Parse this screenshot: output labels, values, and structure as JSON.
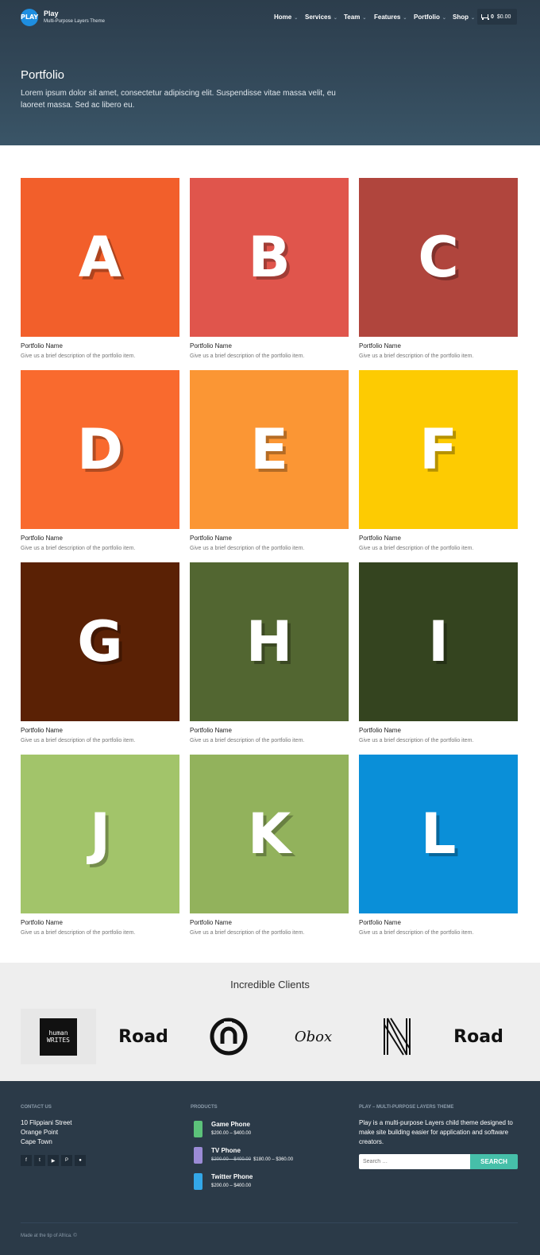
{
  "header": {
    "logo_text": "PLAY",
    "site_name": "Play",
    "tagline": "Multi-Purpose Layers Theme",
    "nav": [
      {
        "label": "Home",
        "caret": "⌄"
      },
      {
        "label": "Services",
        "caret": "⌄"
      },
      {
        "label": "Team",
        "caret": "⌄"
      },
      {
        "label": "Features",
        "caret": "⌄"
      },
      {
        "label": "Portfolio",
        "caret": "⌄"
      },
      {
        "label": "Shop",
        "caret": "⌄"
      }
    ],
    "cart": {
      "count": "0",
      "total": "$0.00",
      "icon": "cart-icon"
    }
  },
  "hero": {
    "title": "Portfolio",
    "description": "Lorem ipsum dolor sit amet, consectetur adipiscing elit. Suspendisse vitae massa velit, eu laoreet massa. Sed ac libero eu."
  },
  "portfolio": [
    {
      "letter": "A",
      "color": "#f25f2b",
      "name": "Portfolio Name",
      "desc": "Give us a brief description of the portfolio item."
    },
    {
      "letter": "B",
      "color": "#e0554c",
      "name": "Portfolio Name",
      "desc": "Give us a brief description of the portfolio item."
    },
    {
      "letter": "C",
      "color": "#b0453d",
      "name": "Portfolio Name",
      "desc": "Give us a brief description of the portfolio item."
    },
    {
      "letter": "D",
      "color": "#f96a2e",
      "name": "Portfolio Name",
      "desc": "Give us a brief description of the portfolio item."
    },
    {
      "letter": "E",
      "color": "#fb9634",
      "name": "Portfolio Name",
      "desc": "Give us a brief description of the portfolio item."
    },
    {
      "letter": "F",
      "color": "#fdcb02",
      "name": "Portfolio Name",
      "desc": "Give us a brief description of the portfolio item."
    },
    {
      "letter": "G",
      "color": "#5a2105",
      "name": "Portfolio Name",
      "desc": "Give us a brief description of the portfolio item."
    },
    {
      "letter": "H",
      "color": "#526631",
      "name": "Portfolio Name",
      "desc": "Give us a brief description of the portfolio item."
    },
    {
      "letter": "I",
      "color": "#34441f",
      "name": "Portfolio Name",
      "desc": "Give us a brief description of the portfolio item."
    },
    {
      "letter": "J",
      "color": "#a2c46a",
      "name": "Portfolio Name",
      "desc": "Give us a brief description of the portfolio item."
    },
    {
      "letter": "K",
      "color": "#92b25c",
      "name": "Portfolio Name",
      "desc": "Give us a brief description of the portfolio item."
    },
    {
      "letter": "L",
      "color": "#0a8fd8",
      "name": "Portfolio Name",
      "desc": "Give us a brief description of the portfolio item."
    }
  ],
  "clients": {
    "title": "Incredible Clients",
    "logos": [
      {
        "name": "human-writes-logo",
        "text": "human WRITES"
      },
      {
        "name": "road-logo",
        "text": "Road"
      },
      {
        "name": "n-circle-logo",
        "text": ""
      },
      {
        "name": "obox-logo",
        "text": "Obox"
      },
      {
        "name": "n-stripes-logo",
        "text": ""
      },
      {
        "name": "road-logo-2",
        "text": "Road"
      }
    ]
  },
  "footer": {
    "contact": {
      "heading": "CONTACT US",
      "lines": [
        "10 Flippiani Street",
        "Orange Point",
        "Cape Town"
      ],
      "socials": [
        {
          "name": "facebook-icon",
          "glyph": "f"
        },
        {
          "name": "twitter-icon",
          "glyph": "t"
        },
        {
          "name": "youtube-icon",
          "glyph": "▶"
        },
        {
          "name": "pinterest-icon",
          "glyph": "P"
        },
        {
          "name": "dribbble-icon",
          "glyph": "●"
        }
      ]
    },
    "products": {
      "heading": "PRODUCTS",
      "items": [
        {
          "name": "Game Phone",
          "old": "",
          "price": "$200.00 – $400.00",
          "color": "#5cc27a"
        },
        {
          "name": "TV Phone",
          "old": "$200.00 – $400.00",
          "price": "$180.00 – $360.00",
          "color": "#9b8bd6"
        },
        {
          "name": "Twitter Phone",
          "old": "",
          "price": "$200.00 – $400.00",
          "color": "#33a7e8"
        }
      ]
    },
    "about": {
      "heading": "PLAY – MULTI-PURPOSE LAYERS THEME",
      "text": "Play is a multi-purpose Layers child theme designed to make site building easier for application and software creators."
    },
    "search": {
      "placeholder": "Search …",
      "button": "SEARCH"
    },
    "copyright": "Made at the tip of Africa. ©"
  }
}
